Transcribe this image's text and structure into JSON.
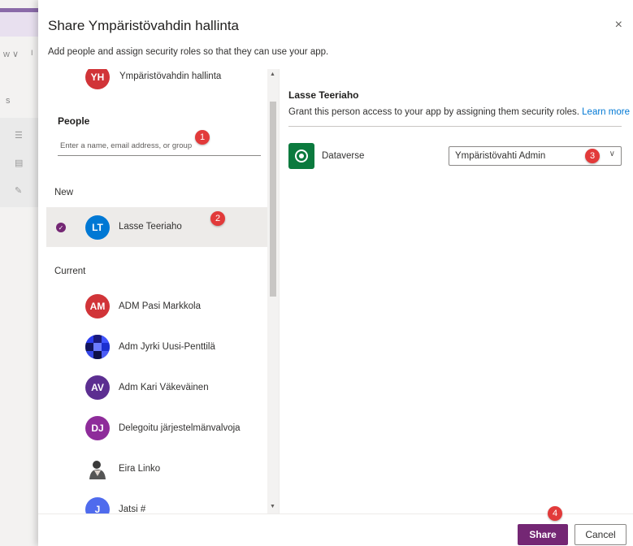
{
  "background": {
    "nav_fragment": "w ∨",
    "nav_fragment_right": "I",
    "side_fragment": "s"
  },
  "dialog": {
    "title": "Share Ympäristövahdin hallinta",
    "subtitle": "Add people and assign security roles so that they can use your app.",
    "close_icon": "×"
  },
  "people_panel": {
    "top_app": {
      "initials": "YH",
      "name": "Ympäristövahdin hallinta",
      "color": "#d13438"
    },
    "heading": "People",
    "search_placeholder": "Enter a name, email address, or group",
    "new_label": "New",
    "new_people": [
      {
        "initials": "LT",
        "name": "Lasse Teeriaho",
        "color": "#0078d4",
        "selected": true
      }
    ],
    "current_label": "Current",
    "current_people": [
      {
        "initials": "AM",
        "name": "ADM Pasi Markkola",
        "color": "#d13438"
      },
      {
        "initials": "",
        "name": "Adm Jyrki Uusi-Penttilä",
        "color": "#1e2fd0",
        "pattern": true
      },
      {
        "initials": "AV",
        "name": "Adm Kari Väkeväinen",
        "color": "#5c2e91"
      },
      {
        "initials": "DJ",
        "name": "Delegoitu järjestelmänvalvoja",
        "color": "#8e2c9a"
      },
      {
        "initials": "",
        "name": "Eira Linko",
        "color": "#ffffff",
        "photo": true
      },
      {
        "initials": "J",
        "name": "Jatsi #",
        "color": "#4f6bed"
      }
    ]
  },
  "detail_panel": {
    "person_name": "Lasse Teeriaho",
    "description": "Grant this person access to your app by assigning them security roles.",
    "learn_more": "Learn more",
    "environment_label": "Dataverse",
    "role_value": "Ympäristövahti Admin"
  },
  "footer": {
    "share_label": "Share",
    "cancel_label": "Cancel"
  },
  "annotations": [
    "1",
    "2",
    "3",
    "4"
  ],
  "colors": {
    "accent": "#742774",
    "badge": "#e23a3a",
    "link": "#0078d4",
    "dataverse": "#0b7a3e"
  }
}
